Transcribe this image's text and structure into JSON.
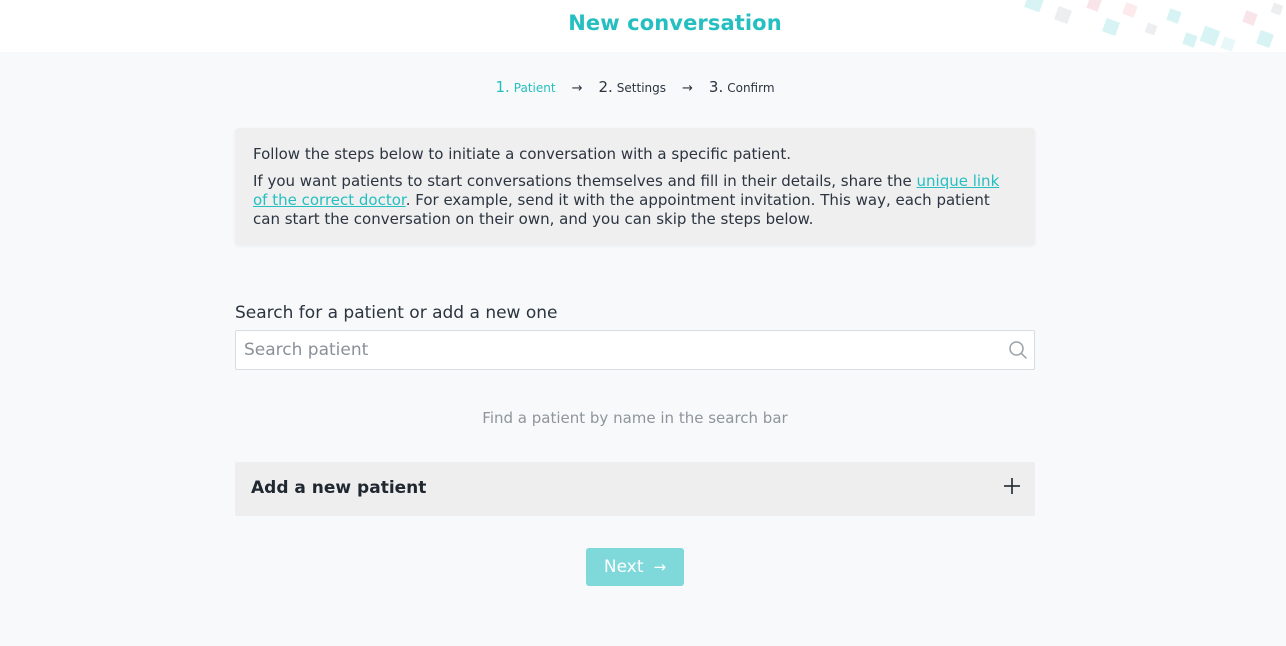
{
  "header": {
    "title": "New conversation"
  },
  "stepper": {
    "steps": [
      {
        "number": "1.",
        "label": "Patient",
        "active": true
      },
      {
        "number": "2.",
        "label": "Settings",
        "active": false
      },
      {
        "number": "3.",
        "label": "Confirm",
        "active": false
      }
    ],
    "separator": "→"
  },
  "info": {
    "line1": "Follow the steps below to initiate a conversation with a specific patient.",
    "line2_before": "If you want patients to start conversations themselves and fill in their details, share the ",
    "link_text": "unique link of the correct doctor",
    "line2_after": ". For example, send it with the appointment invitation. This way, each patient can start the conversation on their own, and you can skip the steps below."
  },
  "search": {
    "label": "Search for a patient or add a new one",
    "placeholder": "Search patient",
    "value": "",
    "icon": "search-icon",
    "hint": "Find a patient by name in the search bar"
  },
  "add_patient": {
    "label": "Add a new patient",
    "icon": "plus-icon"
  },
  "next_button": {
    "label": "Next",
    "arrow": "→",
    "icon": "arrow-right-icon"
  },
  "colors": {
    "accent": "#25bfc1",
    "next_button_disabled": "#7fd9da",
    "background": "#f7f9fa",
    "info_box": "#efefef"
  }
}
